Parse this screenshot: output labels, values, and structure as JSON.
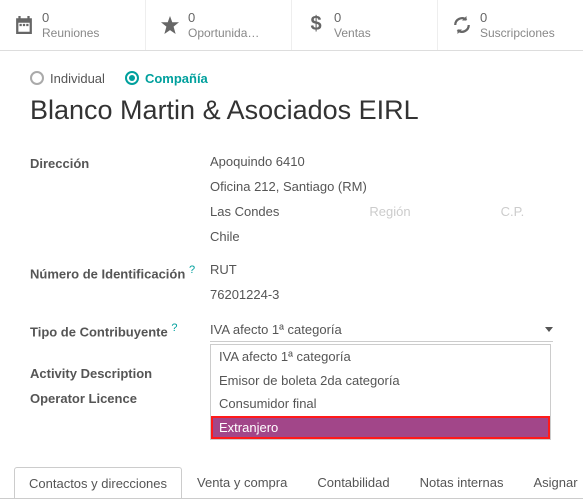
{
  "stats": [
    {
      "count": "0",
      "label": "Reuniones",
      "icon": "calendar"
    },
    {
      "count": "0",
      "label": "Oportunida…",
      "icon": "star"
    },
    {
      "count": "0",
      "label": "Ventas",
      "icon": "dollar"
    },
    {
      "count": "0",
      "label": "Suscripciones",
      "icon": "refresh"
    }
  ],
  "type": {
    "individual": "Individual",
    "company": "Compañía"
  },
  "title": "Blanco Martin & Asociados EIRL",
  "labels": {
    "direccion": "Dirección",
    "numero_id": "Número de Identificación",
    "tipo_contrib": "Tipo de Contribuyente",
    "activity_desc": "Activity Description",
    "operator_lic": "Operator Licence",
    "help": "?"
  },
  "address": {
    "street1": "Apoquindo 6410",
    "street2": "Oficina 212, Santiago (RM)",
    "city": "Las Condes",
    "region_ph": "Región",
    "cp_ph": "C.P.",
    "country": "Chile"
  },
  "id": {
    "type": "RUT",
    "number": "76201224-3"
  },
  "taxpayer": {
    "selected": "IVA afecto 1ª categoría",
    "options": [
      "IVA afecto 1ª categoría",
      "Emisor de boleta 2da categoría",
      "Consumidor final",
      "Extranjero"
    ]
  },
  "tabs": [
    "Contactos y direcciones",
    "Venta y compra",
    "Contabilidad",
    "Notas internas",
    "Asignar"
  ]
}
